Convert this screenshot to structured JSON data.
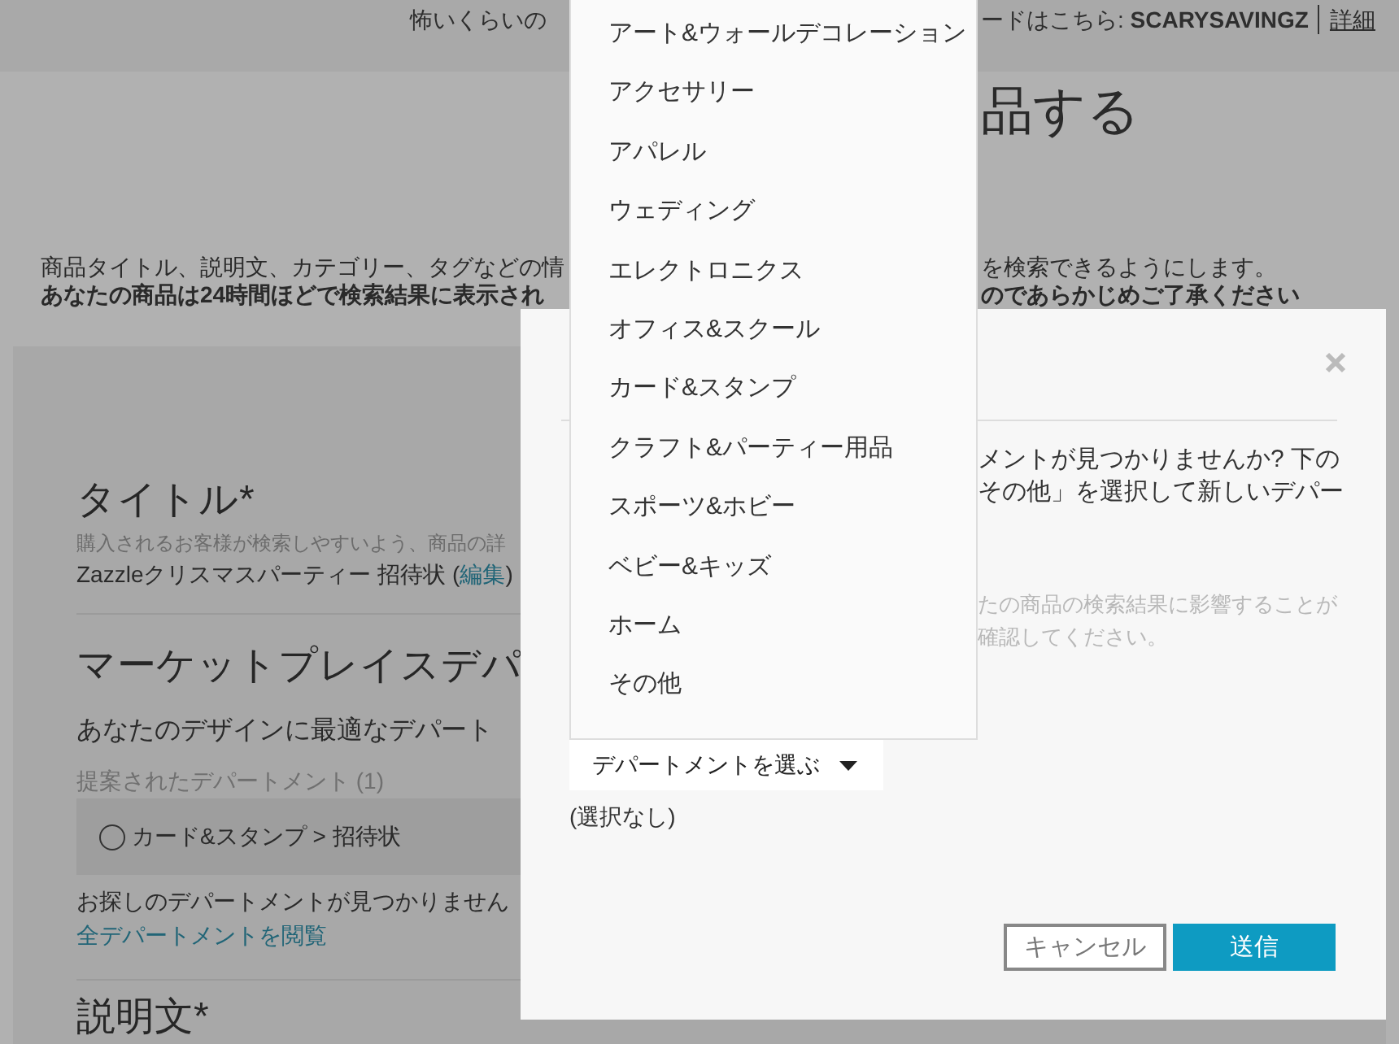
{
  "banner": {
    "text_start": "怖いくらいの",
    "text_end": "ードはこちら: **SCARYSAVINGZ**",
    "link": "詳細"
  },
  "page_title": "品する",
  "intro": {
    "lines": [
      {
        "kind": "plain",
        "start": "商品タイトル、説明文、カテゴリー、タグなどの情",
        "end": "を検索できるようにします。"
      },
      {
        "kind": "note",
        "start": "あなたの商品は24時間ほどで検索結果に表示され",
        "end": "のであらかじめご了承ください"
      }
    ]
  },
  "form": {
    "title": {
      "label": "タイトル*",
      "hint": "購入されるお客様が検索しやすいよう、商品の詳",
      "value": "Zazzleクリスマスパーティー 招待状 (",
      "edit_link": "編集",
      "value_end": ")"
    },
    "department": {
      "heading": "マーケットプレイスデパ",
      "prompt": "あなたのデザインに最適なデパート",
      "suggested_label": "提案されたデパートメント (1)",
      "suggestions": [
        {
          "label": "カード&スタンプ > 招待状",
          "selected": false
        }
      ],
      "not_found": "お探しのデパートメントが見つかりません",
      "browse_link": "全デパートメントを閲覧"
    },
    "description": {
      "label": "説明文*"
    }
  },
  "dialog": {
    "lines": [
      "メントが見つかりませんか? 下の",
      "その他」を選択して新しいデパー"
    ],
    "note_lines": [
      "たの商品の検索結果に影響することが",
      "確認してください。"
    ],
    "select_label": "デパートメントを選ぶ",
    "selection": "(選択なし)",
    "buttons": [
      {
        "label": "キャンセル",
        "kind": "secondary"
      },
      {
        "label": "送信",
        "kind": "primary"
      }
    ]
  },
  "dropdown": {
    "items": [
      {
        "label": "アート&ウォールデコレーション",
        "selected": false
      },
      {
        "label": "アクセサリー",
        "selected": false
      },
      {
        "label": "アパレル",
        "selected": false
      },
      {
        "label": "ウェディング",
        "selected": false
      },
      {
        "label": "エレクトロニクス",
        "selected": false
      },
      {
        "label": "オフィス&スクール",
        "selected": false
      },
      {
        "label": "カード&スタンプ",
        "selected": false
      },
      {
        "label": "クラフト&パーティー用品",
        "selected": false
      },
      {
        "label": "スポーツ&ホビー",
        "selected": false
      },
      {
        "label": "ベビー&キッズ",
        "selected": false
      },
      {
        "label": "ホーム",
        "selected": false
      },
      {
        "label": "その他",
        "selected": false
      }
    ]
  }
}
